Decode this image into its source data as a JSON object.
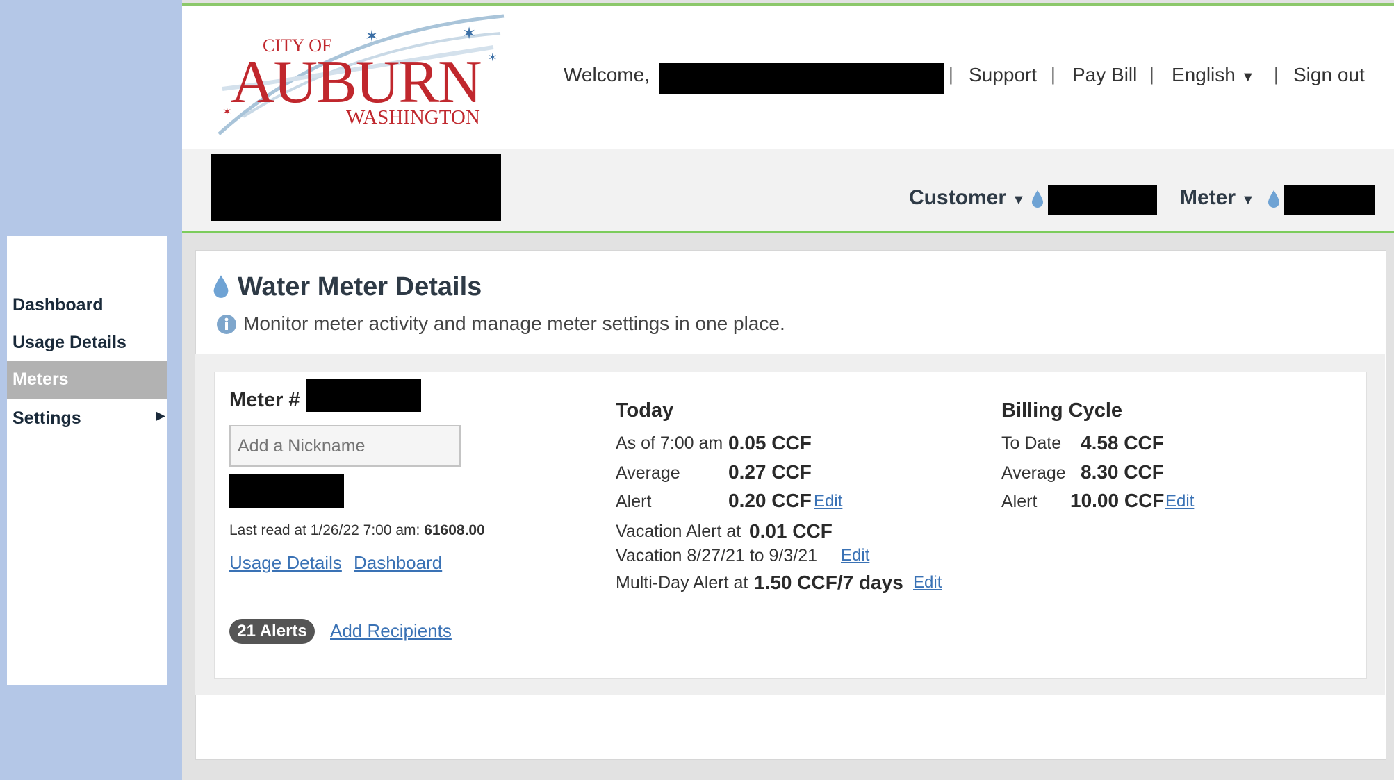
{
  "header": {
    "logo_top": "CITY OF",
    "logo_main": "AUBURN",
    "logo_bottom": "WASHINGTON",
    "welcome": "Welcome,",
    "support": "Support",
    "pay_bill": "Pay Bill",
    "language": "English",
    "sign_out": "Sign out"
  },
  "subbar": {
    "customer": "Customer",
    "meter": "Meter"
  },
  "sidebar": {
    "items": [
      {
        "label": "Dashboard"
      },
      {
        "label": "Usage Details"
      },
      {
        "label": "Meters"
      },
      {
        "label": "Settings"
      }
    ]
  },
  "page": {
    "title": "Water Meter Details",
    "subtitle": "Monitor meter activity and manage meter settings in one place."
  },
  "meter": {
    "label": "Meter #",
    "nickname_placeholder": "Add a Nickname",
    "last_read_prefix": "Last read at 1/26/22 7:00 am:",
    "last_read_value": "61608.00",
    "usage_link": "Usage Details",
    "dashboard_link": "Dashboard",
    "alerts_badge": "21 Alerts",
    "add_recipients": "Add Recipients"
  },
  "today": {
    "heading": "Today",
    "as_of_label": "As of 7:00 am",
    "as_of_value": "0.05 CCF",
    "average_label": "Average",
    "average_value": "0.27 CCF",
    "alert_label": "Alert",
    "alert_value": "0.20 CCF",
    "edit": "Edit",
    "vacation_alert_label": "Vacation Alert at",
    "vacation_alert_value": "0.01 CCF",
    "vacation_dates": "Vacation 8/27/21 to 9/3/21",
    "multi_day_label": "Multi-Day Alert at",
    "multi_day_value": "1.50 CCF/7 days"
  },
  "billing": {
    "heading": "Billing Cycle",
    "to_date_label": "To Date",
    "to_date_value": "4.58 CCF",
    "average_label": "Average",
    "average_value": "8.30 CCF",
    "alert_label": "Alert",
    "alert_value": "10.00 CCF",
    "edit": "Edit"
  },
  "colors": {
    "accent_green": "#7ccc5c",
    "brand_red": "#c0272d",
    "link_blue": "#3a72b5",
    "side_blue": "#b4c7e7"
  },
  "icons": [
    "water-drop-icon",
    "info-icon",
    "caret-down-icon",
    "caret-right-icon"
  ]
}
